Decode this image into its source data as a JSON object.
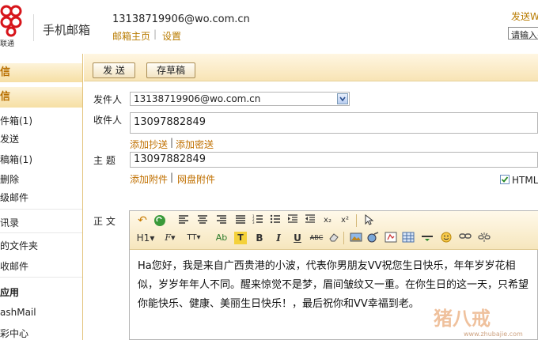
{
  "header": {
    "logo_text": "联通",
    "app_title": "手机邮箱",
    "account": "13138719906@wo.com.cn",
    "links": {
      "home": "邮箱主页",
      "separator": "|",
      "settings": "设置"
    },
    "send_sms": "发送W",
    "search_placeholder": "请输入关",
    "brand_color": "#d7141a"
  },
  "sidebar": {
    "compose": "信",
    "inbox": "信",
    "items": [
      "件箱(1)",
      "发送",
      "稿箱(1)",
      "删除",
      "级邮件",
      "讯录",
      "的文件夹",
      "收邮件",
      "应用",
      "ashMail",
      "彩中心"
    ]
  },
  "compose": {
    "send_button": "发 送",
    "draft_button": "存草稿",
    "from_label": "发件人",
    "from_value": "13138719906@wo.com.cn",
    "to_label": "收件人",
    "to_value": "13097882849",
    "add_cc": "添加抄送",
    "link_sep": "|",
    "add_bcc": "添加密送",
    "subject_label": "主  题",
    "subject_value": "13097882849",
    "add_attachment": "添加附件",
    "disk_attachment": "网盘附件",
    "html_checkbox": "HTML",
    "body_label": "正  文",
    "body_text": "Ha您好，我是来自广西贵港的小波，代表你男朋友VV祝您生日快乐，年年岁岁花相似，岁岁年年人不同。醒来惊觉不是梦，眉间皱纹又一重。在你生日的这一天，只希望你能快乐、健康、美丽生日快乐！，最后祝你和VV幸福到老。"
  },
  "editor_toolbar": {
    "row1": [
      "undo-icon",
      "redo-icon",
      "align-left-icon",
      "align-center-icon",
      "align-right-icon",
      "justify-icon",
      "ordered-list-icon",
      "bullet-list-icon",
      "indent-icon",
      "outdent-icon",
      "subscript-icon",
      "superscript-icon",
      "select-icon"
    ],
    "row2_labels": {
      "heading": "H1",
      "font": "F",
      "size": "TT",
      "fontcolor": "Ab",
      "highlight": "T",
      "bold": "B",
      "italic": "I",
      "underline": "U",
      "strike": "ABC"
    },
    "sub": "x₂",
    "sup": "x²"
  },
  "watermark": {
    "text": "猪八戒",
    "sub": "www.zhubajie.com"
  }
}
